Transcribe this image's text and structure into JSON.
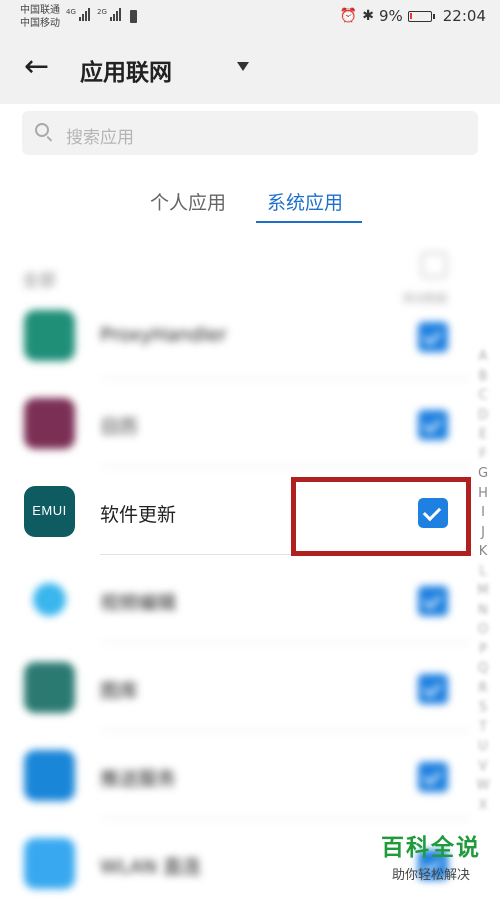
{
  "status_bar": {
    "carrier_1": "中国联通",
    "carrier_2": "中国移动",
    "network_1": "4G",
    "network_2": "2G",
    "battery": "9%",
    "battery_level": 0.09,
    "time": "22:04"
  },
  "header": {
    "title": "应用联网"
  },
  "search": {
    "placeholder": "搜索应用"
  },
  "tabs": [
    {
      "label": "个人应用",
      "selected": false
    },
    {
      "label": "系统应用",
      "selected": true
    }
  ],
  "list_header": {
    "all_label": "全部",
    "select_all_label": "移动数据"
  },
  "apps": [
    {
      "name": "ProxyHandler",
      "checked": true,
      "icon": "proxyhandler-icon",
      "color": "#1f8f78"
    },
    {
      "name": "日历",
      "checked": true,
      "icon": "calendar-icon",
      "color": "#7c2f55"
    },
    {
      "name": "软件更新",
      "checked": true,
      "icon": "emui-icon",
      "icon_text": "EMUI",
      "color": "#0f5b62"
    },
    {
      "name": "视频编辑",
      "checked": true,
      "icon": "video-edit-icon",
      "color": "#39b6ee"
    },
    {
      "name": "图库",
      "checked": true,
      "icon": "gallery-icon",
      "color": "#2b7a72"
    },
    {
      "name": "推送服务",
      "checked": true,
      "icon": "push-service-icon",
      "color": "#1a86d8"
    },
    {
      "name": "WLAN 直连",
      "checked": true,
      "icon": "wlan-direct-icon",
      "color": "#38a9f0"
    }
  ],
  "index_letters": [
    "A",
    "B",
    "C",
    "D",
    "E",
    "F",
    "G",
    "H",
    "I",
    "J",
    "K",
    "L",
    "M",
    "N",
    "O",
    "P",
    "Q",
    "R",
    "S",
    "T",
    "U",
    "V",
    "W",
    "X"
  ],
  "watermark": {
    "title": "百科全说",
    "subtitle": "助你轻松解决"
  },
  "colors": {
    "accent": "#1e6fcc",
    "checkbox": "#1e80e0",
    "highlight": "#b0201f",
    "watermark": "#1f9b3c"
  }
}
